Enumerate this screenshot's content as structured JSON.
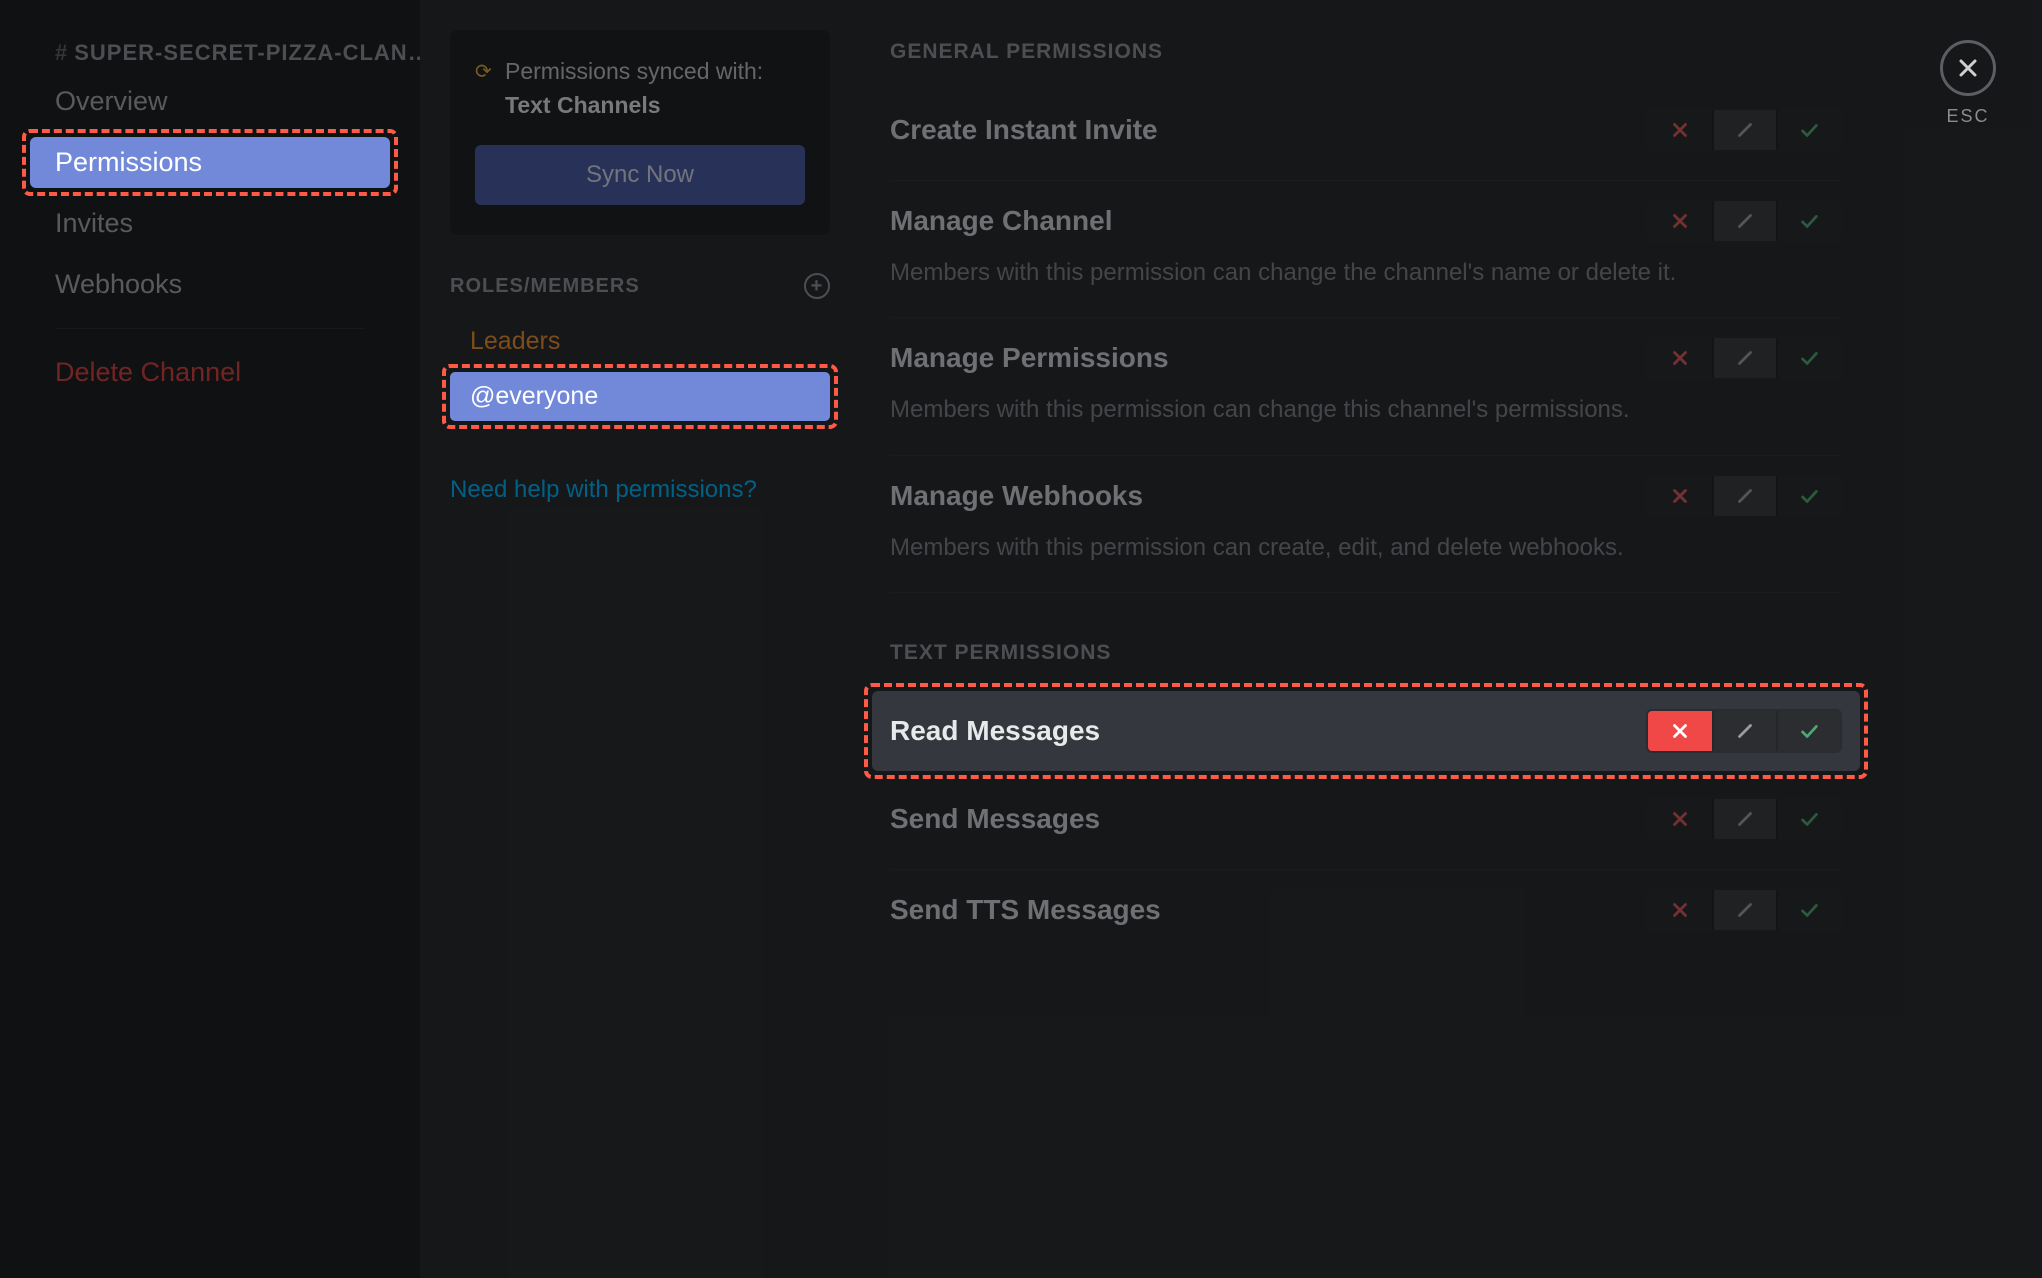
{
  "channel": {
    "name": "SUPER-SECRET-PIZZA-CLAN…"
  },
  "sidebar": {
    "items": [
      {
        "label": "Overview"
      },
      {
        "label": "Permissions"
      },
      {
        "label": "Invites"
      },
      {
        "label": "Webhooks"
      }
    ],
    "delete_label": "Delete Channel"
  },
  "sync": {
    "line1": "Permissions synced with:",
    "parent": "Text Channels",
    "button": "Sync Now"
  },
  "roles": {
    "header": "ROLES/MEMBERS",
    "items": [
      {
        "name": "Leaders",
        "kind": "role"
      },
      {
        "name": "@everyone",
        "kind": "default",
        "selected": true
      }
    ]
  },
  "help_link": "Need help with permissions?",
  "permissions": {
    "sections": [
      {
        "label": "GENERAL PERMISSIONS",
        "items": [
          {
            "title": "Create Instant Invite",
            "desc": "",
            "state": "pass"
          },
          {
            "title": "Manage Channel",
            "desc": "Members with this permission can change the channel's name or delete it.",
            "state": "pass"
          },
          {
            "title": "Manage Permissions",
            "desc": "Members with this permission can change this channel's permissions.",
            "state": "pass"
          },
          {
            "title": "Manage Webhooks",
            "desc": "Members with this permission can create, edit, and delete webhooks.",
            "state": "pass"
          }
        ]
      },
      {
        "label": "TEXT PERMISSIONS",
        "items": [
          {
            "title": "Read Messages",
            "desc": "",
            "state": "deny",
            "highlight": true
          },
          {
            "title": "Send Messages",
            "desc": "",
            "state": "pass"
          },
          {
            "title": "Send TTS Messages",
            "desc": "",
            "state": "pass"
          }
        ]
      }
    ]
  },
  "close": {
    "label": "ESC"
  }
}
